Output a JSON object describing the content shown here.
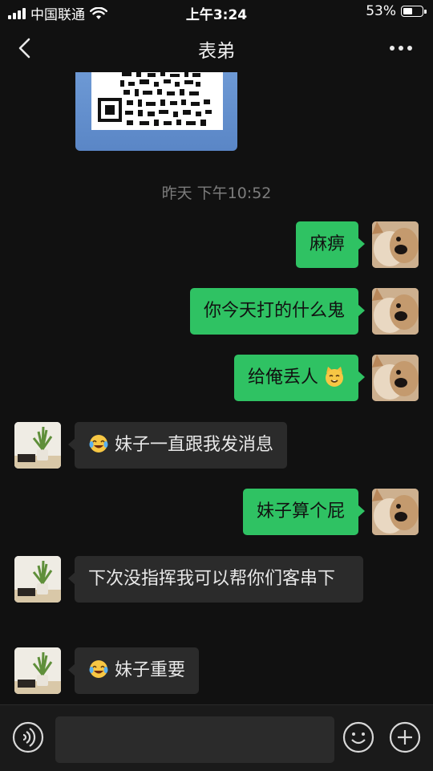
{
  "status_bar": {
    "carrier": "中国联通",
    "time": "上午3:24",
    "battery_percent": "53%",
    "battery_level": 0.53
  },
  "header": {
    "title": "表弟"
  },
  "chat": {
    "timestamp": "昨天 下午10:52",
    "messages": [
      {
        "side": "out",
        "text": "麻痹"
      },
      {
        "side": "out",
        "text": "你今天打的什么鬼"
      },
      {
        "side": "out",
        "text": "给俺丢人",
        "emoji": "cat-emoji"
      },
      {
        "side": "in",
        "text": "妹子一直跟我发消息",
        "emoji": "tears-of-joy-emoji"
      },
      {
        "side": "out",
        "text": "妹子算个屁"
      },
      {
        "side": "in",
        "text": "下次没指挥我可以帮你们客串下"
      },
      {
        "side": "in",
        "text": "妹子重要",
        "emoji": "tears-of-joy-emoji"
      }
    ]
  },
  "input_bar": {
    "placeholder": ""
  },
  "colors": {
    "background": "#111111",
    "outgoing_bubble": "#2fc263",
    "incoming_bubble": "#2b2b2b"
  }
}
